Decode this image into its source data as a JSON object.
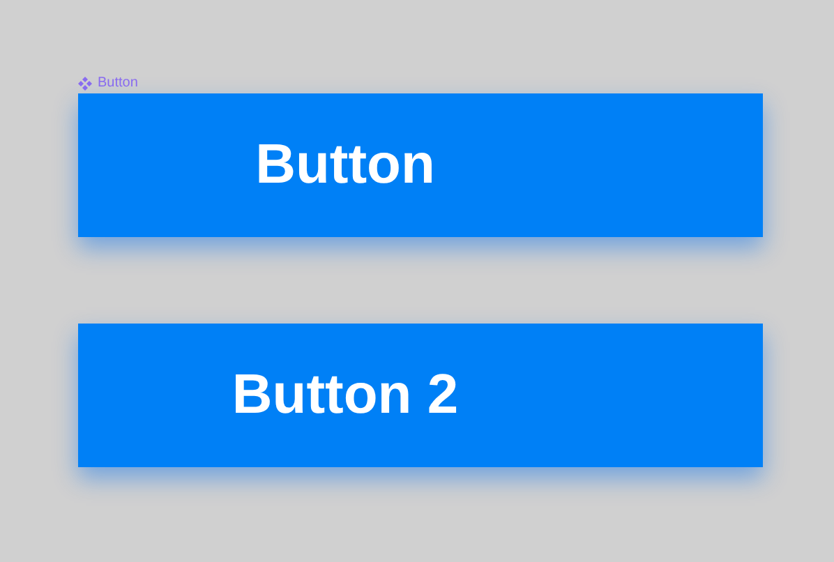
{
  "component_label": "Button",
  "buttons": [
    {
      "label": "Button"
    },
    {
      "label": "Button 2"
    }
  ]
}
